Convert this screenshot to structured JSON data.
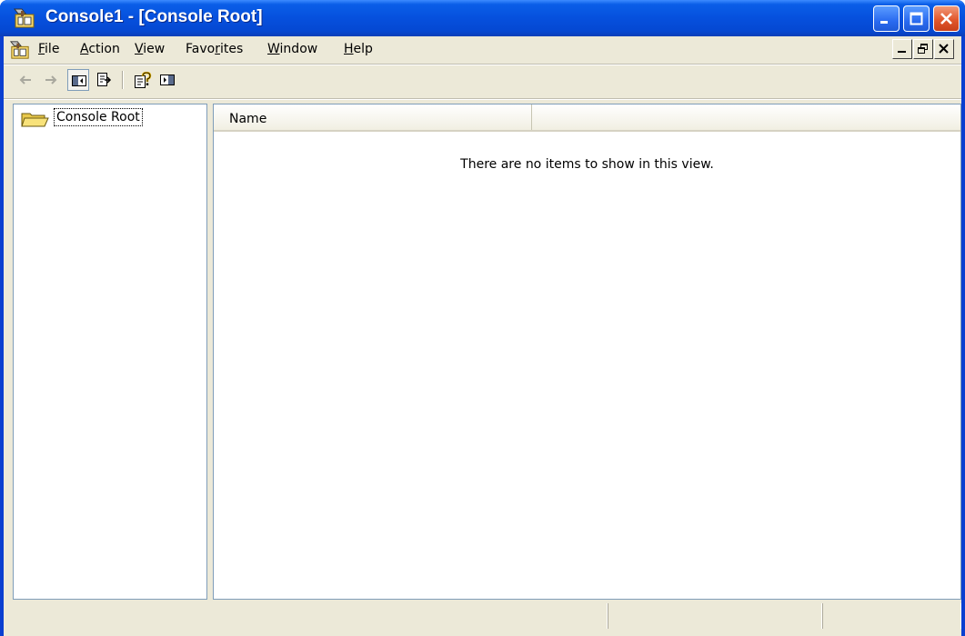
{
  "window": {
    "title": "Console1 - [Console Root]",
    "colors": {
      "titlebar": "#0650dd",
      "close_button": "#e2572c",
      "client": "#ece9d8"
    },
    "caption_buttons": [
      "minimize-icon",
      "maximize-icon",
      "close-icon"
    ]
  },
  "menu": {
    "app_icon": "mmc-console-icon",
    "items": [
      {
        "label": "File"
      },
      {
        "label": "Action"
      },
      {
        "label": "View"
      },
      {
        "label": "Favorites"
      },
      {
        "label": "Window"
      },
      {
        "label": "Help"
      }
    ],
    "child_window_buttons": [
      "minimize-icon",
      "restore-icon",
      "close-icon"
    ]
  },
  "toolbar": {
    "buttons": [
      {
        "icon": "back-arrow-icon",
        "enabled": false
      },
      {
        "icon": "forward-arrow-icon",
        "enabled": false
      },
      {
        "icon": "show-hide-console-tree-icon",
        "pressed": true
      },
      {
        "icon": "export-list-icon"
      },
      {
        "icon": "help-icon"
      },
      {
        "icon": "show-hide-action-pane-icon"
      }
    ]
  },
  "tree": {
    "items": [
      {
        "label": "Console Root",
        "icon": "open-folder-icon",
        "selected": true
      }
    ]
  },
  "list": {
    "columns": [
      {
        "label": "Name"
      }
    ],
    "empty_message": "There are no items to show in this view."
  },
  "status": {
    "cells": [
      "",
      "",
      ""
    ]
  }
}
